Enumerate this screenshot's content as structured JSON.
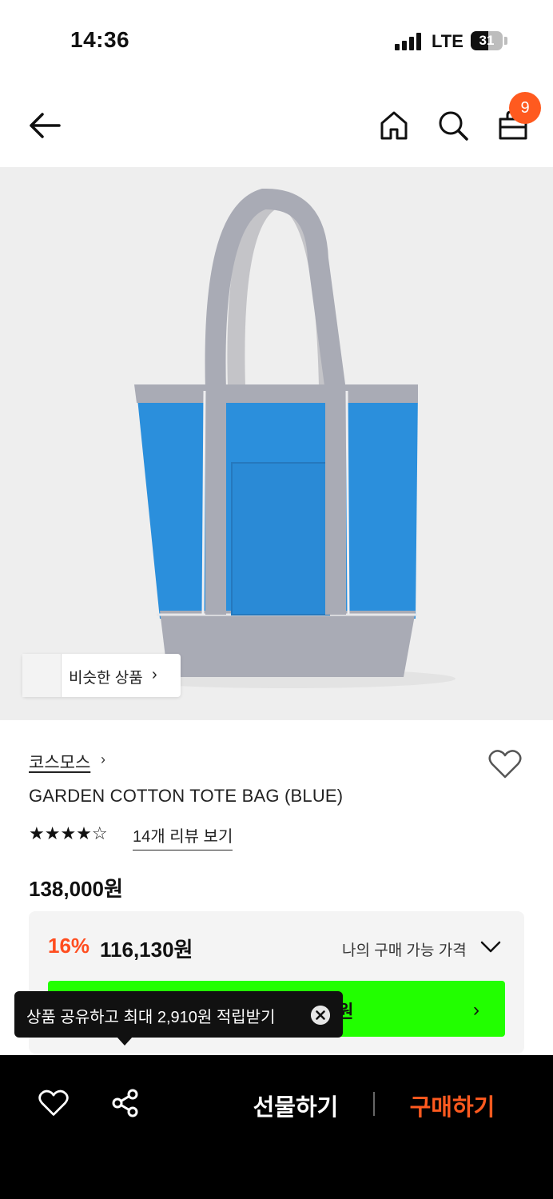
{
  "status_bar": {
    "time": "14:36",
    "network": "LTE",
    "battery": "31"
  },
  "nav": {
    "back_icon": "arrow-left-icon",
    "home_icon": "home-icon",
    "search_icon": "search-icon",
    "cart_icon": "shopping-bag-icon",
    "cart_count": "9"
  },
  "gallery": {
    "similar_button": "비슷한 상품",
    "similar_chevron": "›"
  },
  "product": {
    "brand": "코스모스",
    "brand_chevron": "›",
    "name": "GARDEN COTTON TOTE BAG (BLUE)",
    "rating": 4.5,
    "stars": "★★★★",
    "review_link": "14개 리뷰 보기",
    "price": "138,000원"
  },
  "price_box": {
    "discount": "16%",
    "sale_price": "116,130원",
    "my_price_label": "나의 구매 가능 가격",
    "green_button_text": "0원",
    "green_button_chevron": "›"
  },
  "tooltip": {
    "text": "상품 공유하고 최대 2,910원 적립받기"
  },
  "bottom_bar": {
    "wishlist_icon": "heart-icon",
    "share_icon": "share-icon",
    "gift_label": "선물하기",
    "buy_label": "구매하기"
  },
  "colors": {
    "accent": "#ff5a1f",
    "promo_green": "#22ff00",
    "bag_blue": "#2b8fdc",
    "bag_gray": "#a9abb5"
  }
}
